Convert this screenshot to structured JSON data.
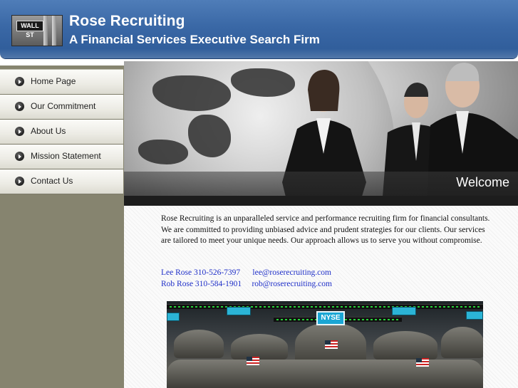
{
  "header": {
    "title": "Rose Recruiting",
    "subtitle": "A Financial Services Executive Search Firm",
    "logo_sign": "WALL ST",
    "colors": {
      "bar": "#3a68a6",
      "text": "#ffffff"
    }
  },
  "nav": {
    "items": [
      {
        "label": "Home Page"
      },
      {
        "label": "Our Commitment"
      },
      {
        "label": "About Us"
      },
      {
        "label": "Mission Statement"
      },
      {
        "label": "Contact Us"
      }
    ],
    "bullet_icon": "arrow-circle-icon",
    "colors": {
      "sidebar": "#86846f",
      "item": "#ecebe4"
    }
  },
  "hero": {
    "welcome": "Welcome"
  },
  "content": {
    "intro": "Rose Recruiting  is an unparalleled  service and performance recruiting firm for financial consultants. We are committed to providing unbiased advice and prudent strategies for our clients. Our services are  tailored to meet your unique needs. Our approach allows us to serve you without compromise.",
    "contacts": [
      {
        "name_phone": "Lee Rose 310-526-7397",
        "email": "lee@roserecruiting.com"
      },
      {
        "name_phone": "Rob Rose 310-584-1901",
        "email": "rob@roserecruiting.com"
      }
    ],
    "floor_sign": "NYSE",
    "link_color": "#1f2fc8"
  }
}
